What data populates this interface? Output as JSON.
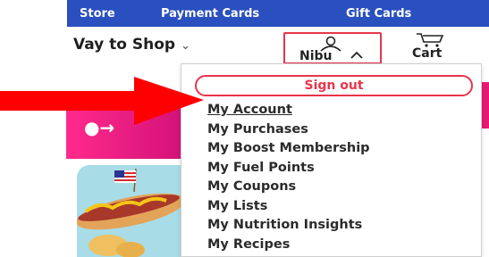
{
  "topbar": {
    "links": [
      "Store",
      "Payment Cards",
      "Gift Cards"
    ]
  },
  "header": {
    "ways_to_shop": "Vay to Shop",
    "account_name": "Nibu",
    "cart_label": "Cart"
  },
  "menu": {
    "signout_label": "Sign out",
    "items": [
      "My Account",
      "My Purchases",
      "My Boost Membership",
      "My Fuel Points",
      "My Coupons",
      "My Lists",
      "My Nutrition Insights",
      "My Recipes"
    ]
  },
  "colors": {
    "brand_blue": "#2a4fbf",
    "accent_red": "#e8354a",
    "banner_pink": "#e61a74",
    "arrow_red": "#ff0000"
  },
  "icons": [
    "person-icon",
    "chevron-down-icon",
    "chevron-up-icon",
    "cart-icon",
    "arrow-annotation"
  ]
}
